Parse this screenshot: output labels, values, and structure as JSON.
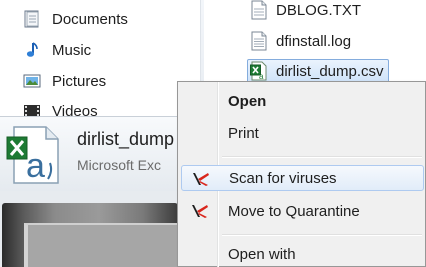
{
  "nav_pane": {
    "items": [
      {
        "label": "Documents",
        "icon": "documents-icon"
      },
      {
        "label": "Music",
        "icon": "music-icon"
      },
      {
        "label": "Pictures",
        "icon": "pictures-icon"
      },
      {
        "label": "Videos",
        "icon": "videos-icon"
      }
    ]
  },
  "file_list": {
    "files": [
      {
        "name": "DBLOG.TXT",
        "icon": "text-file-icon"
      },
      {
        "name": "dfinstall.log",
        "icon": "log-file-icon"
      },
      {
        "name": "dirlist_dump.csv",
        "icon": "excel-csv-icon",
        "selected": true
      }
    ]
  },
  "taskbar_preview": {
    "title": "dirlist_dump",
    "subtitle": "Microsoft Exc",
    "icon": "excel-document-icon"
  },
  "context_menu": {
    "items": [
      {
        "label": "Open",
        "bold": true
      },
      {
        "label": "Print"
      },
      {
        "label": "Scan for viruses",
        "icon": "antivirus-scan-icon",
        "highlighted": true
      },
      {
        "label": "Move to Quarantine",
        "icon": "quarantine-icon"
      },
      {
        "label": "Open with"
      }
    ]
  },
  "colors": {
    "menu_background": "#f0f0f0",
    "menu_highlight_border": "#aecaf0",
    "selection_border": "#84acdd",
    "antivirus_accent": "#d9261c"
  }
}
